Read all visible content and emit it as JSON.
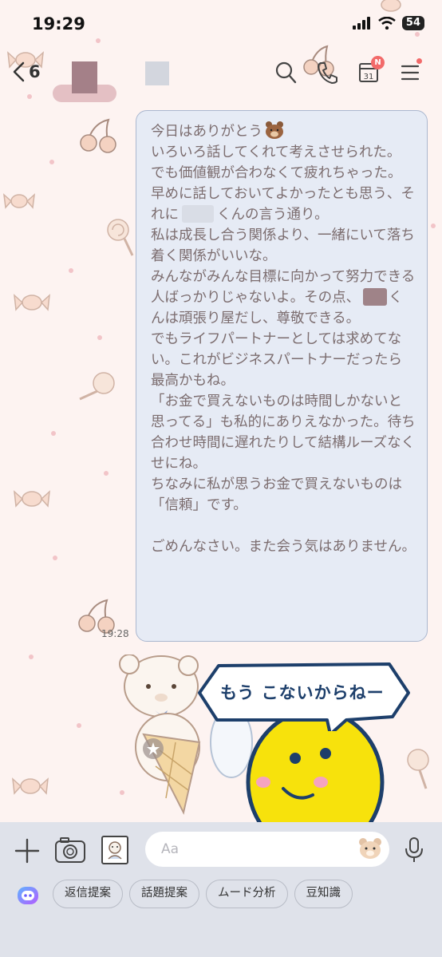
{
  "status_bar": {
    "time": "19:29",
    "battery": "54"
  },
  "header": {
    "unread_count": "6"
  },
  "message": {
    "lines": [
      "いろいろ話してくれて考えさせられた。",
      "でも価値観が合わなくて疲れちゃった。",
      "早めに話しておいてよかったとも思う、それに",
      "くんの言う通り。",
      "私は成長し合う関係より、一緒にいて落ち着く関係がいいな。",
      "みんながみんな目標に向かって努力できる人ばっかりじゃないよ。その点、",
      "くんは頑張り屋だし、尊敬できる。",
      "でもライフパートナーとしては求めてない。これがビジネスパートナーだったら最高かもね。",
      "「お金で買えないものは時間しかないと思ってる」も私的にありえなかった。待ち合わせ時間に遅れたりして結構ルーズなくせにね。",
      "ちなみに私が思うお金で買えないものは「信頼」です。",
      "ごめんなさい。また会う気はありません。"
    ],
    "first_line": "今日はありがとう",
    "time": "19:28"
  },
  "sticker": {
    "text": "もう こないからねー"
  },
  "input": {
    "placeholder": "Aa"
  },
  "suggestions": [
    "返信提案",
    "話題提案",
    "ムード分析",
    "豆知識"
  ],
  "colors": {
    "bubble": "#e6ebf5",
    "bubble_border": "#aab7cf",
    "text": "#7c6d6f",
    "background": "#fdf3f1",
    "badge": "#f26a6a"
  },
  "icons": [
    "back-icon",
    "search-icon",
    "phone-icon",
    "calendar-icon",
    "menu-icon",
    "plus-icon",
    "camera-icon",
    "photo-icon",
    "bear-emoji-icon",
    "mic-icon",
    "ai-assistant-icon"
  ]
}
